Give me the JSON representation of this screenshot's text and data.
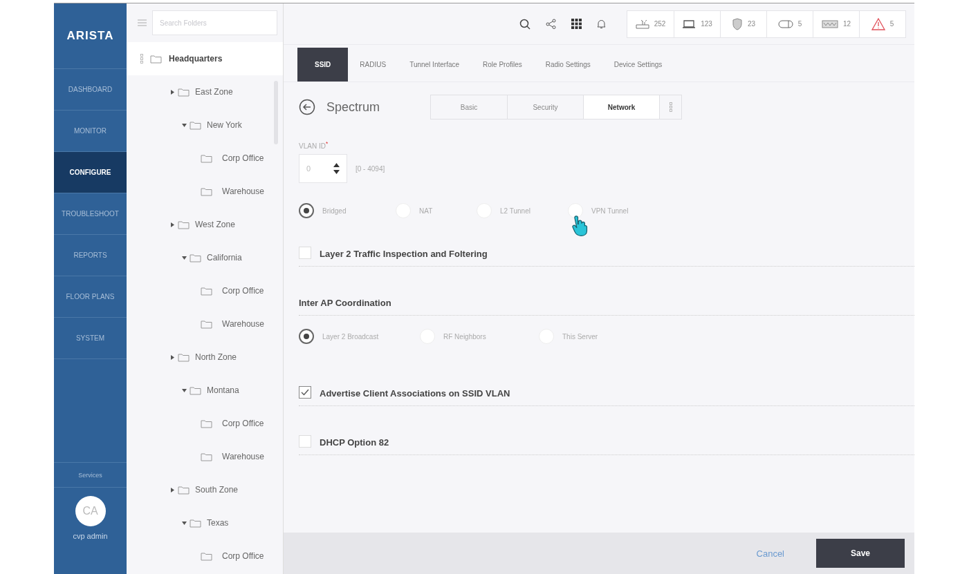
{
  "logo": "ARISTA",
  "nav": [
    {
      "label": "DASHBOARD",
      "selected": false
    },
    {
      "label": "MONITOR",
      "selected": false
    },
    {
      "label": "CONFIGURE",
      "selected": true
    },
    {
      "label": "TROUBLESHOOT",
      "selected": false
    },
    {
      "label": "REPORTS",
      "selected": false
    },
    {
      "label": "FLOOR PLANS",
      "selected": false
    },
    {
      "label": "SYSTEM",
      "selected": false
    }
  ],
  "services": "Services",
  "user": {
    "initials": "CA",
    "name": "cvp admin"
  },
  "folder_search": {
    "placeholder": "Search Folders"
  },
  "tree": {
    "label": "Headquarters",
    "children": [
      {
        "label": "East Zone",
        "expanded": false,
        "children": [
          {
            "label": "New York",
            "expanded": true,
            "children": [
              {
                "label": "Corp Office"
              },
              {
                "label": "Warehouse"
              }
            ]
          }
        ]
      },
      {
        "label": "West Zone",
        "expanded": false,
        "children": [
          {
            "label": "California",
            "expanded": true,
            "children": [
              {
                "label": "Corp Office"
              },
              {
                "label": "Warehouse"
              }
            ]
          }
        ]
      },
      {
        "label": "North Zone",
        "expanded": false,
        "children": [
          {
            "label": "Montana",
            "expanded": true,
            "children": [
              {
                "label": "Corp Office"
              },
              {
                "label": "Warehouse"
              }
            ]
          }
        ]
      },
      {
        "label": "South Zone",
        "expanded": false,
        "children": [
          {
            "label": "Texas",
            "expanded": true,
            "children": [
              {
                "label": "Corp Office"
              }
            ]
          }
        ]
      }
    ]
  },
  "stats": [
    {
      "count": "252"
    },
    {
      "count": "123"
    },
    {
      "count": "23"
    },
    {
      "count": "5"
    },
    {
      "count": "12"
    },
    {
      "count": "5"
    }
  ],
  "tabs": [
    {
      "label": "SSID",
      "selected": true
    },
    {
      "label": "RADIUS",
      "selected": false
    },
    {
      "label": "Tunnel Interface",
      "selected": false
    },
    {
      "label": "Role Profiles",
      "selected": false
    },
    {
      "label": "Radio Settings",
      "selected": false
    },
    {
      "label": "Device Settings",
      "selected": false
    }
  ],
  "profile_title": "Spectrum",
  "subtabs": [
    {
      "label": "Basic",
      "selected": false
    },
    {
      "label": "Security",
      "selected": false
    },
    {
      "label": "Network",
      "selected": true
    }
  ],
  "vlan": {
    "label": "VLAN ID",
    "required_mark": "*",
    "value": "0",
    "range": "[0 - 4094]"
  },
  "mode_options": [
    {
      "label": "Bridged",
      "selected": true
    },
    {
      "label": "NAT",
      "selected": false
    },
    {
      "label": "L2 Tunnel",
      "selected": false
    },
    {
      "label": "VPN Tunnel",
      "selected": false
    }
  ],
  "sections": [
    {
      "kind": "checkbox",
      "label": "Layer 2 Traffic Inspection and Foltering",
      "checked": false
    },
    {
      "kind": "radios",
      "label": "Inter AP Coordination",
      "options": [
        {
          "label": "Layer 2 Broadcast",
          "selected": true
        },
        {
          "label": "RF Neighbors",
          "selected": false
        },
        {
          "label": "This Server",
          "selected": false
        }
      ]
    },
    {
      "kind": "checkbox",
      "label": "Advertise Client Associations on SSID VLAN",
      "checked": true
    },
    {
      "kind": "checkbox",
      "label": "DHCP Option 82",
      "checked": false
    }
  ],
  "buttons": {
    "cancel": "Cancel",
    "save": "Save"
  }
}
